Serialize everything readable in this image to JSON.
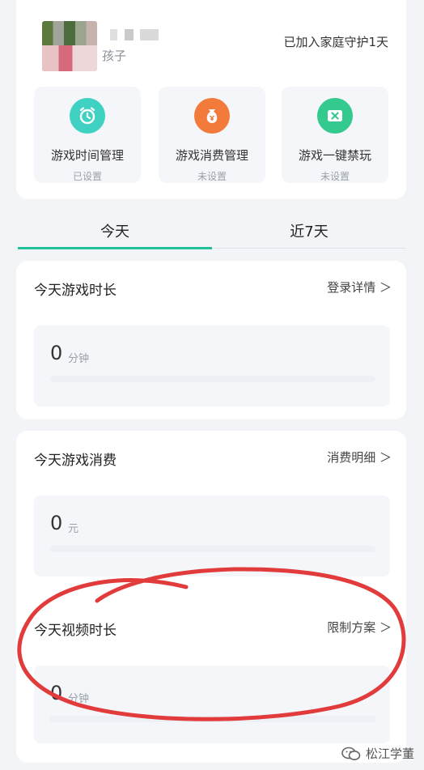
{
  "profile": {
    "role": "孩子",
    "guard_days_text": "已加入家庭守护1天"
  },
  "features": [
    {
      "name": "游戏时间管理",
      "state": "已设置",
      "icon": "alarm-clock-icon",
      "color": "#3fd1c2"
    },
    {
      "name": "游戏消费管理",
      "state": "未设置",
      "icon": "money-bag-icon",
      "color": "#f27a3a"
    },
    {
      "name": "游戏一键禁玩",
      "state": "未设置",
      "icon": "block-screen-icon",
      "color": "#34c98e"
    }
  ],
  "tabs": [
    {
      "label": "今天",
      "active": true
    },
    {
      "label": "近7天",
      "active": false
    }
  ],
  "stats": {
    "game_time": {
      "title": "今天游戏时长",
      "link": "登录详情 ＞",
      "value": "0",
      "unit": "分钟"
    },
    "game_spend": {
      "title": "今天游戏消费",
      "link": "消费明细 ＞",
      "value": "0",
      "unit": "元"
    },
    "video_time": {
      "title": "今天视频时长",
      "link": "限制方案 ＞",
      "value": "0",
      "unit": "分钟"
    }
  },
  "watermark": "松江学董",
  "colors": {
    "accent": "#1fc19a",
    "annotation": "#e23b3b"
  }
}
